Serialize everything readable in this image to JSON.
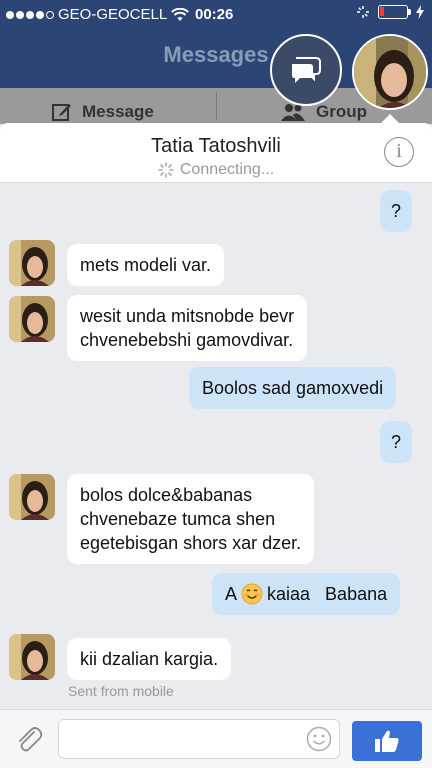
{
  "status_bar": {
    "carrier": "GEO-GEOCELL",
    "time": "00:26"
  },
  "header": {
    "title": "Messages",
    "tab_message": "Message",
    "tab_group": "Group"
  },
  "chat": {
    "contact_name": "Tatia Tatoshvili",
    "connection_status": "Connecting...",
    "messages": [
      {
        "from": "me",
        "text": "?"
      },
      {
        "from": "them",
        "text": "mets modeli var."
      },
      {
        "from": "them",
        "text_line1": "wesit unda mitsnobde bevr",
        "text_line2": "chvenebebshi gamovdivar."
      },
      {
        "from": "me",
        "text": "Boolos sad gamoxvedi"
      },
      {
        "from": "me",
        "text": "?"
      },
      {
        "from": "them",
        "text_line1": "bolos dolce&babanas",
        "text_line2": "chvenebaze tumca shen",
        "text_line3": "egetebisgan shors xar dzer."
      },
      {
        "from": "me",
        "text_before": "A",
        "text_after": "kaiaa   Babana"
      },
      {
        "from": "them",
        "text": "kii dzalian kargia."
      }
    ],
    "sent_from": "Sent from mobile"
  },
  "composer": {
    "placeholder": ""
  },
  "colors": {
    "header_bg": "#2c4575",
    "outgoing_bubble": "#cde3f7",
    "like_button": "#3b70d6"
  }
}
